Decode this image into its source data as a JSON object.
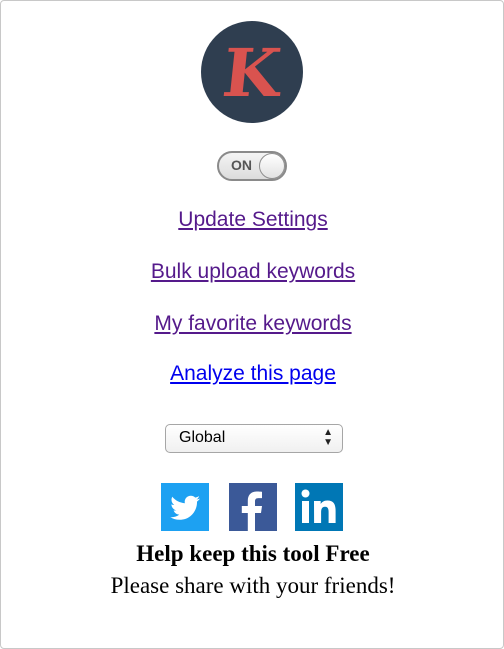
{
  "logo": {
    "letter": "K",
    "circle_color": "#2f3e50",
    "letter_color": "#d9534f"
  },
  "toggle": {
    "label": "ON",
    "state": "on"
  },
  "links": {
    "update_settings": "Update Settings",
    "bulk_upload": "Bulk upload keywords",
    "favorites": "My favorite keywords",
    "analyze": "Analyze this page"
  },
  "region_select": {
    "selected": "Global"
  },
  "social": {
    "twitter_icon": "twitter-bird-icon",
    "facebook_icon": "facebook-f-icon",
    "linkedin_icon": "linkedin-in-icon",
    "twitter_color": "#1da1f2",
    "facebook_color": "#3b5998",
    "linkedin_color": "#0077b5"
  },
  "share": {
    "title": "Help keep this tool Free",
    "subtitle": "Please share with your friends!"
  }
}
